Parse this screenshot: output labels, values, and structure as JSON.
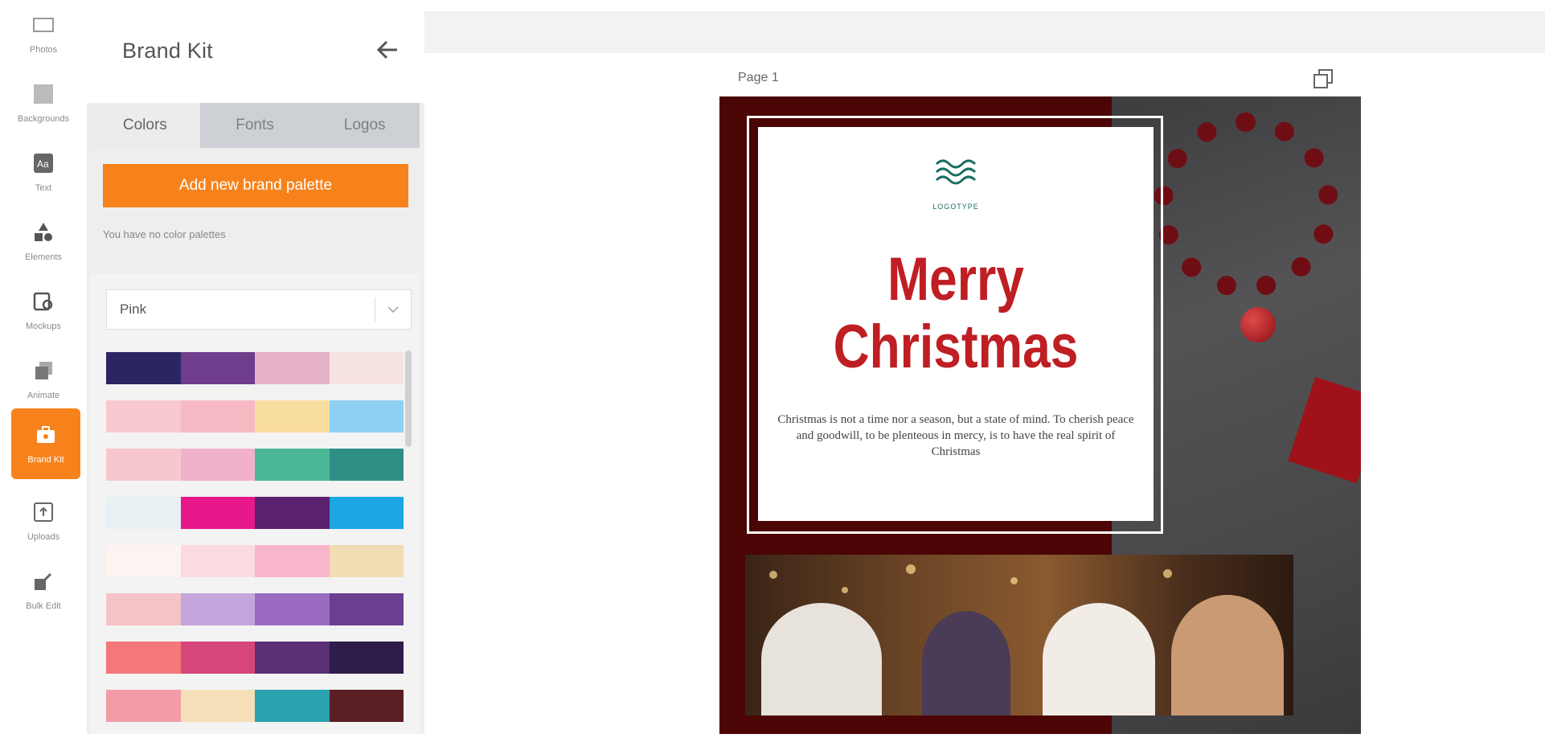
{
  "rail": {
    "items": [
      {
        "label": "Photos"
      },
      {
        "label": "Backgrounds"
      },
      {
        "label": "Text"
      },
      {
        "label": "Elements"
      },
      {
        "label": "Mockups"
      },
      {
        "label": "Animate"
      },
      {
        "label": "Brand Kit"
      },
      {
        "label": "Uploads"
      },
      {
        "label": "Bulk Edit"
      }
    ]
  },
  "panel": {
    "title": "Brand Kit",
    "tabs": [
      {
        "label": "Colors",
        "active": true
      },
      {
        "label": "Fonts",
        "active": false
      },
      {
        "label": "Logos",
        "active": false
      }
    ],
    "add_button": "Add new brand palette",
    "empty_note": "You have no color palettes",
    "palette_select": "Pink",
    "palettes": [
      [
        "#2b2564",
        "#6f3d8c",
        "#e6b2c8",
        "#f7e2e2"
      ],
      [
        "#f8c9cf",
        "#f6b9c4",
        "#f9dd9e",
        "#8ed0f4"
      ],
      [
        "#f7c7d0",
        "#f2b1cb",
        "#4cb898",
        "#2f8f86"
      ],
      [
        "#e9f0f4",
        "#e7188a",
        "#5a216f",
        "#1aa7e4"
      ],
      [
        "#fdf3f1",
        "#fbdbe0",
        "#f8b6cb",
        "#f1dcb3"
      ],
      [
        "#f6c3c8",
        "#c6a5dc",
        "#9a6bc0",
        "#6a3f8f"
      ],
      [
        "#f4777a",
        "#d6467a",
        "#5b2f73",
        "#2e1c4a"
      ],
      [
        "#f29da6",
        "#f5dfb8",
        "#2aa2ae",
        "#5b1e24"
      ]
    ]
  },
  "workspace": {
    "page_label": "Page 1"
  },
  "design": {
    "logo_text": "LOGOTYPE",
    "headline_line1": "Merry",
    "headline_line2": "Christmas",
    "quote": "Christmas is not a time nor a season, but a state of mind. To cherish peace and goodwill, to be plenteous in mercy, is to have the real spirit of Christmas"
  },
  "colors": {
    "accent": "#f7821b",
    "headline": "#bf1e23",
    "design_bg": "#4b0505"
  }
}
